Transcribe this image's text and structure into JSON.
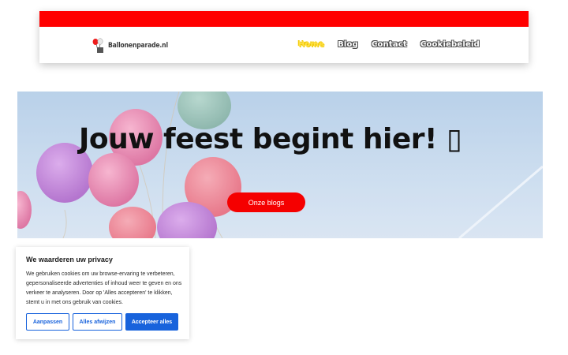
{
  "header": {
    "logo_text": "Ballonenparade.nl",
    "brand_color": "#ff0000",
    "active_color": "#ffe14a",
    "nav": [
      {
        "label": "Home",
        "active": true
      },
      {
        "label": "Blog",
        "active": false
      },
      {
        "label": "Contact",
        "active": false
      },
      {
        "label": "Cookiebeleid",
        "active": false
      }
    ]
  },
  "hero": {
    "title": "Jouw feest begint hier! ▯",
    "button_label": "Onze blogs",
    "button_color": "#f50000"
  },
  "cookie": {
    "title": "We waarderen uw privacy",
    "text": "We gebruiken cookies om uw browse-ervaring te verbeteren, gepersonaliseerde advertenties of inhoud weer te geven en ons verkeer te analyseren. Door op 'Alles accepteren' te klikken, stemt u in met ons gebruik van cookies.",
    "customize_label": "Aanpassen",
    "reject_label": "Alles afwijzen",
    "accept_label": "Accepteer alles",
    "accent_color": "#1863dc"
  }
}
